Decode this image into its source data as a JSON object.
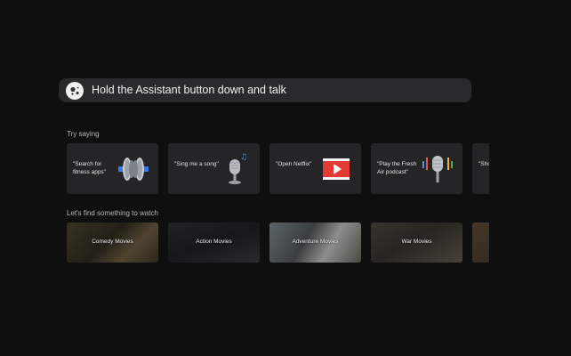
{
  "assistant_bar": {
    "prompt": "Hold the Assistant button down and talk",
    "icon": "google-assistant-icon"
  },
  "try_saying": {
    "label": "Try saying",
    "cards": [
      {
        "text": "\"Search for fitness apps\"",
        "icon": "dumbbell-icon"
      },
      {
        "text": "\"Sing me a song\"",
        "icon": "microphone-music-icon"
      },
      {
        "text": "\"Open Netflix\"",
        "icon": "play-video-icon"
      },
      {
        "text": "\"Play the Fresh Air podcast\"",
        "icon": "podcast-microphone-icon"
      },
      {
        "text": "\"Show video",
        "icon": ""
      }
    ]
  },
  "watch": {
    "label": "Let's find something to watch",
    "items": [
      {
        "label": "Comedy Movies"
      },
      {
        "label": "Action Movies"
      },
      {
        "label": "Adventure Movies"
      },
      {
        "label": "War Movies"
      },
      {
        "label": ""
      }
    ]
  },
  "colors": {
    "background": "#0f0f10",
    "card": "#252527",
    "accent_red": "#e53935",
    "accent_blue": "#2f6fd6"
  }
}
